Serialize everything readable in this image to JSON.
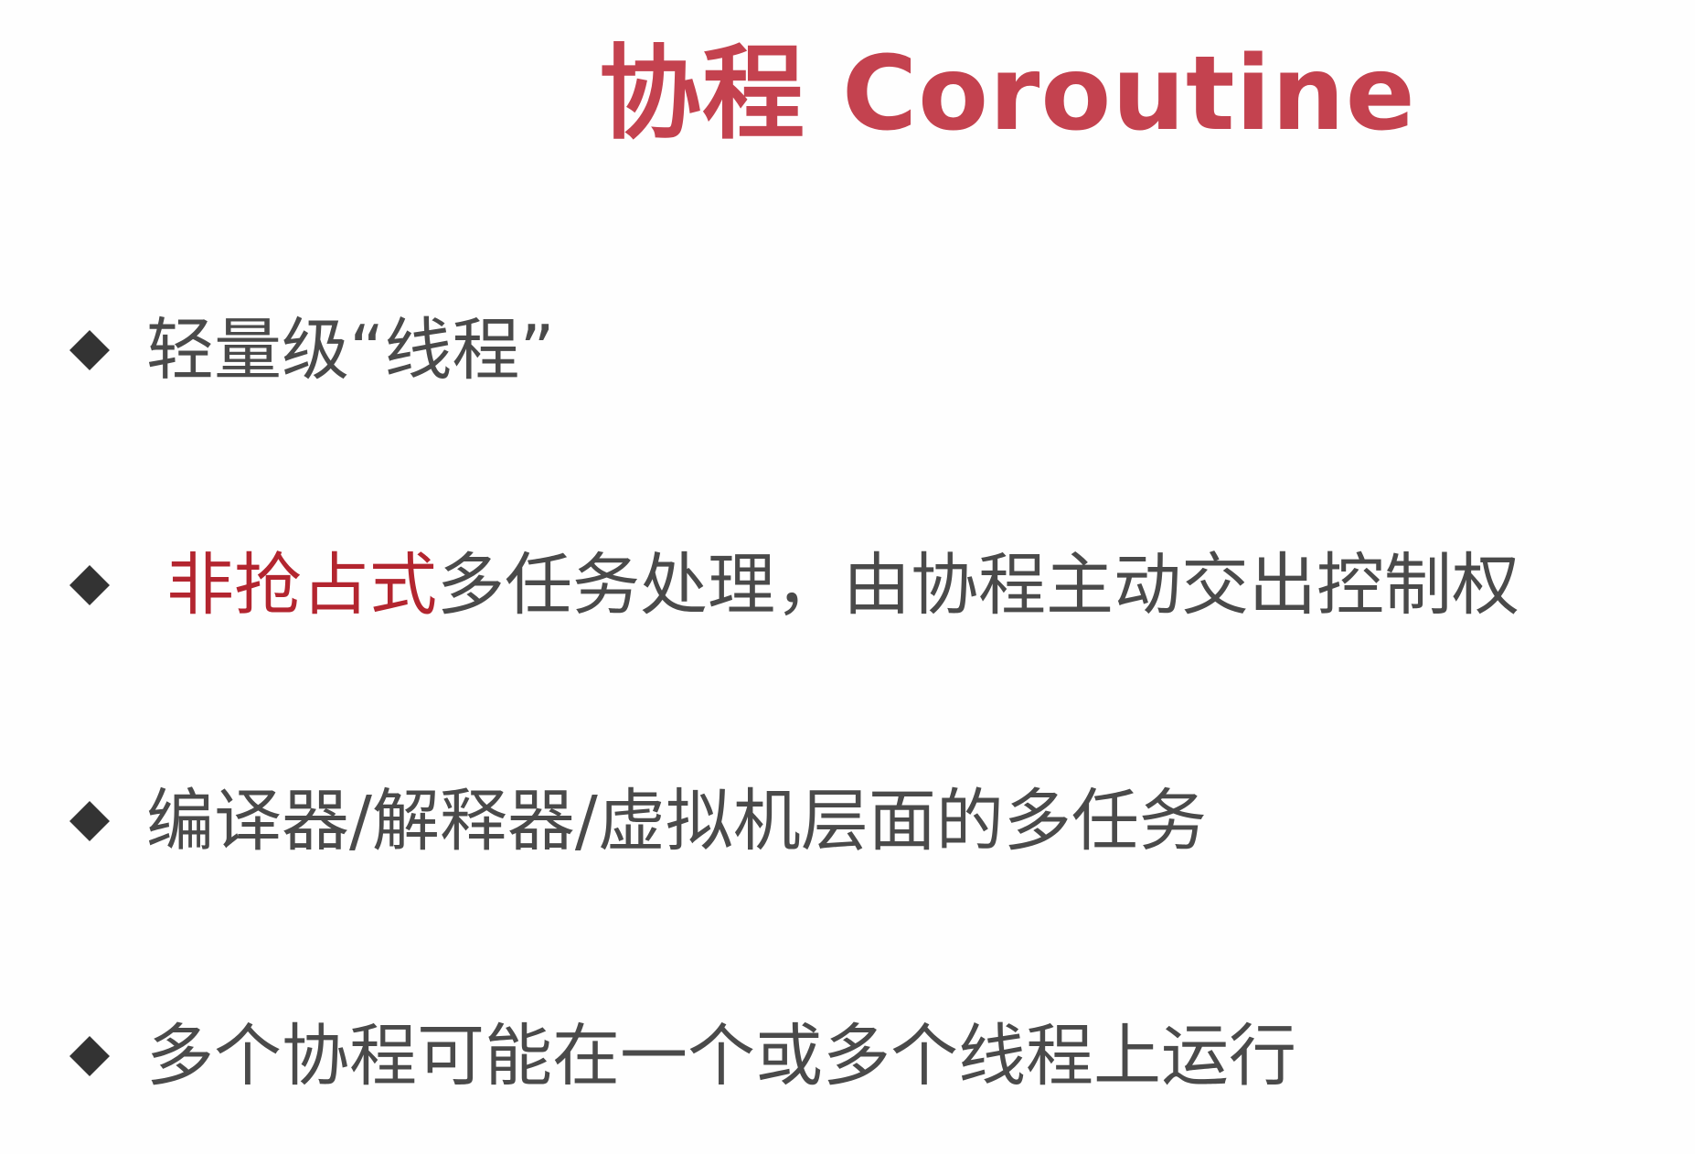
{
  "slide": {
    "title": "协程 Coroutine",
    "bullets": [
      {
        "text": "轻量级“线程”"
      },
      {
        "highlight": "非抢占式",
        "rest": "多任务处理，由协程主动交出控制权"
      },
      {
        "text": "编译器/解释器/虚拟机层面的多任务"
      },
      {
        "text": "多个协程可能在一个或多个线程上运行"
      }
    ],
    "icons": {
      "bullet": "diamond-bullet-icon"
    },
    "colors": {
      "title": "#c4424f",
      "highlight": "#b3252f",
      "body_text": "#4a4a4a",
      "bullet": "#333333",
      "background": "#fefefe"
    }
  }
}
